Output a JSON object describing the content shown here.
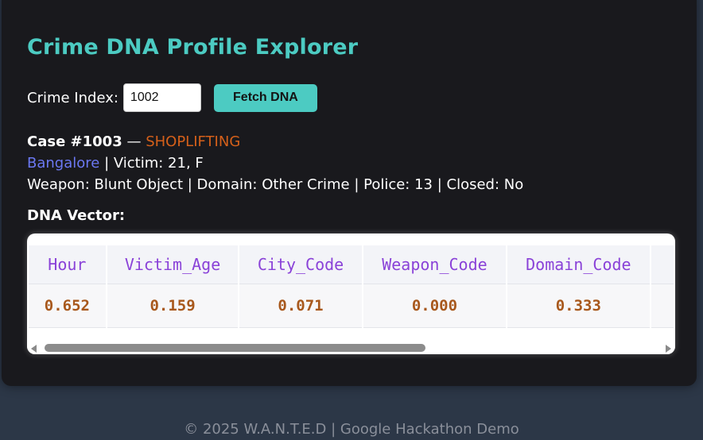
{
  "app": {
    "title": "Crime DNA Profile Explorer"
  },
  "form": {
    "label": "Crime Index:",
    "input_value": "1002",
    "button_label": "Fetch DNA"
  },
  "case": {
    "label": "Case #1003",
    "separator": " — ",
    "crime_type": "SHOPLIFTING",
    "city": "Bangalore",
    "victim": "| Victim: 21, F",
    "details": "Weapon: Blunt Object | Domain: Other Crime | Police: 13 | Closed: No"
  },
  "dna": {
    "title": "DNA Vector:",
    "headers": [
      "Hour",
      "Victim_Age",
      "City_Code",
      "Weapon_Code",
      "Domain_Code"
    ],
    "values": [
      "0.652",
      "0.159",
      "0.071",
      "0.000",
      "0.333"
    ]
  },
  "footer": {
    "text": "© 2025 W.A.N.T.E.D | Google Hackathon Demo"
  },
  "colors": {
    "accent": "#4ccbc2",
    "crime_type": "#d5601a",
    "city_link": "#6b78f2",
    "header_text": "#8a42d8",
    "value_text": "#a8581c",
    "card_bg": "#19191d",
    "page_bg": "#2c3747"
  }
}
